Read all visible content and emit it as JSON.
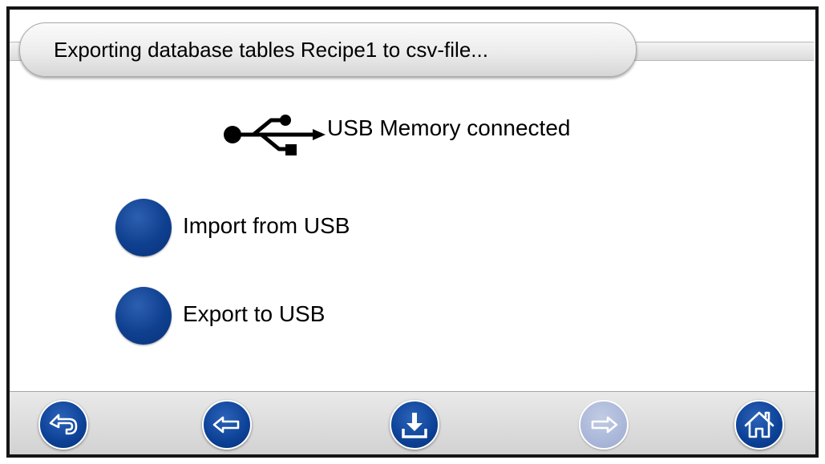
{
  "title_bar": {
    "text": "Exporting database tables Recipe1 to csv-file..."
  },
  "usb_status": {
    "icon": "usb-icon",
    "text": "USB Memory connected"
  },
  "options": [
    {
      "label": "Import from USB"
    },
    {
      "label": "Export to USB"
    }
  ],
  "nav_bar": {
    "buttons": [
      {
        "icon": "return-icon",
        "enabled": true
      },
      {
        "icon": "arrow-left-icon",
        "enabled": true
      },
      {
        "icon": "download-icon",
        "enabled": true
      },
      {
        "icon": "arrow-right-icon",
        "enabled": false
      },
      {
        "icon": "home-icon",
        "enabled": true
      }
    ]
  },
  "colors": {
    "button_blue": "#0e3f8f",
    "button_disabled": "#a7b4d7",
    "frame": "#141414",
    "bar_gray": "#d2d2d2"
  }
}
